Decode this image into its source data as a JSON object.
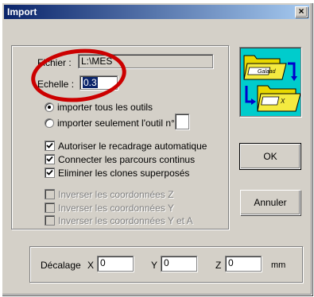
{
  "window": {
    "title": "Import",
    "close_glyph": "×"
  },
  "file": {
    "label": "Fichier :",
    "value": "L:\\MES"
  },
  "scale": {
    "label": "Echelle :",
    "value": "0.3"
  },
  "tools": {
    "import_all_label": "importer tous les outils",
    "import_one_label": "importer seulement l'outil n°",
    "tool_number_value": ""
  },
  "options": {
    "auto_reframe_label": "Autoriser le recadrage automatique",
    "connect_paths_label": "Connecter les parcours continus",
    "remove_clones_label": "Eliminer les clones superposés"
  },
  "invert": {
    "z_label": "Inverser les coordonnées Z",
    "y_label": "Inverser les coordonnées Y",
    "ya_label": "Inverser les coordonnées Y et A"
  },
  "buttons": {
    "ok_label": "OK",
    "cancel_label": "Annuler"
  },
  "offset": {
    "label": "Décalage",
    "x_label": "X",
    "x_value": "0",
    "y_label": "Y",
    "y_value": "0",
    "z_label": "Z",
    "z_value": "0",
    "unit": "mm"
  },
  "icon": {
    "top_folder_text": "Galaad",
    "bottom_folder_text": "X"
  },
  "colors": {
    "annotation": "#cc0000",
    "icon_background": "#00cccc",
    "titlebar": "#0a246a",
    "selection": "#0a246a"
  }
}
